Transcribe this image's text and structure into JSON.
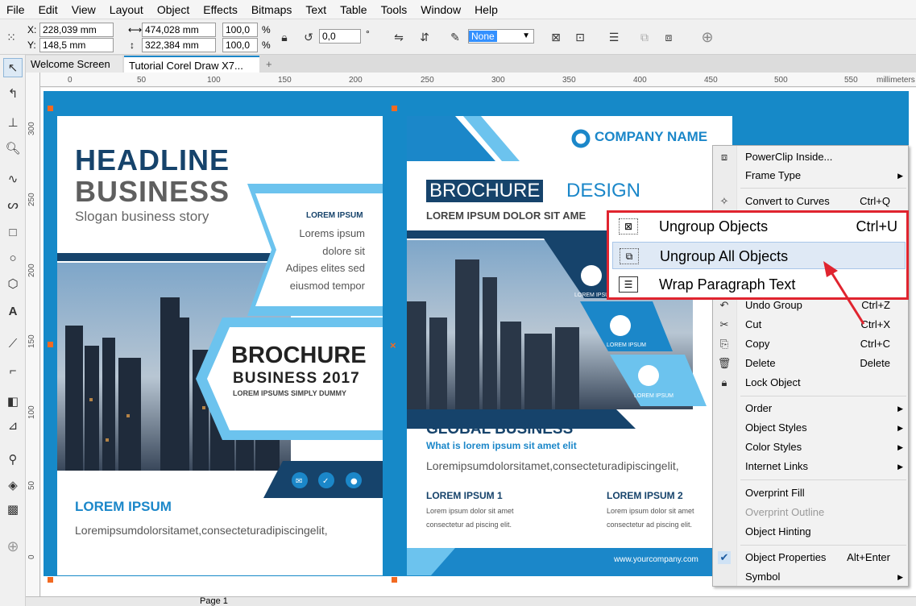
{
  "menu": [
    "File",
    "Edit",
    "View",
    "Layout",
    "Object",
    "Effects",
    "Bitmaps",
    "Text",
    "Table",
    "Tools",
    "Window",
    "Help"
  ],
  "propbar": {
    "x_label": "X:",
    "x_value": "228,039 mm",
    "y_label": "Y:",
    "y_value": "148,5 mm",
    "width_value": "474,028 mm",
    "height_value": "322,384 mm",
    "scale_x": "100,0",
    "scale_y": "100,0",
    "percent": "%",
    "rotation": "0,0",
    "degree": "°",
    "outline_select": "None"
  },
  "tabs": {
    "welcome": "Welcome Screen",
    "doc": "Tutorial Corel Draw X7...",
    "add": "+"
  },
  "ruler": {
    "unit": "millimeters",
    "h_ticks": [
      "0",
      "50",
      "100",
      "150",
      "200",
      "250",
      "300",
      "350",
      "400",
      "450",
      "500",
      "550"
    ],
    "v_ticks": [
      "300",
      "250",
      "200",
      "150",
      "100",
      "50",
      "0"
    ]
  },
  "left_page": {
    "headline": "HEADLINE",
    "business": "BUSINESS",
    "slogan": "Slogan business story",
    "lorem_caps": "LOREM IPSUM",
    "body_lines": [
      "Lorems ipsum",
      "dolore sit",
      "Adipes elites sed",
      "eiusmod tempor"
    ],
    "brochure": "BROCHURE",
    "business_2017": "BUSINESS  2017",
    "lorem_small": "LOREM IPSUMS SIMPLY DUMMY",
    "bottom_title": "LOREM IPSUM",
    "bottom_text": "Loremipsumdolorsitamet,consecteturadipiscingelit,"
  },
  "right_page": {
    "company": "COMPANY NAME",
    "brochure": "BROCHURE",
    "design": "DESIGN",
    "sub": "LOREM IPSUM DOLOR SIT AME",
    "icon_labels": [
      "LOREM IPSUM",
      "LOREM IPSUM",
      "LOREM IPSUM"
    ],
    "global": "GLOBAL BUSINESS",
    "global_sub": "What is lorem ipsum sit amet elit",
    "global_text": "Loremipsumdolorsitamet,consecteturadipiscingelit,",
    "col1_title": "LOREM IPSUM 1",
    "col1_text": [
      "Lorem ipsum dolor sit amet",
      "consectetur ad piscing elit."
    ],
    "col2_title": "LOREM IPSUM 2",
    "col2_text": [
      "Lorem ipsum dolor sit amet",
      "consectetur ad piscing elit."
    ],
    "website": "www.yourcompany.com"
  },
  "context_menu": {
    "powerclip": "PowerClip Inside...",
    "frame_type": "Frame Type",
    "convert": "Convert to Curves",
    "convert_sc": "Ctrl+Q",
    "undo": "Undo Group",
    "undo_sc": "Ctrl+Z",
    "cut": "Cut",
    "cut_sc": "Ctrl+X",
    "copy": "Copy",
    "copy_sc": "Ctrl+C",
    "delete": "Delete",
    "delete_sc": "Delete",
    "lock": "Lock Object",
    "order": "Order",
    "styles": "Object Styles",
    "color_styles": "Color Styles",
    "internet": "Internet Links",
    "overprint_fill": "Overprint Fill",
    "overprint_outline": "Overprint Outline",
    "hinting": "Object Hinting",
    "properties": "Object Properties",
    "properties_sc": "Alt+Enter",
    "symbol": "Symbol"
  },
  "callout": {
    "ungroup": "Ungroup Objects",
    "ungroup_sc": "Ctrl+U",
    "ungroup_all": "Ungroup All Objects",
    "wrap": "Wrap Paragraph Text"
  },
  "status": {
    "page": "Page 1"
  },
  "colors": {
    "workspace": "#1689c8",
    "accent": "#1b87c9",
    "navy": "#16436b",
    "highlight": "#e0242f",
    "light_blue": "#6cc3ee"
  }
}
